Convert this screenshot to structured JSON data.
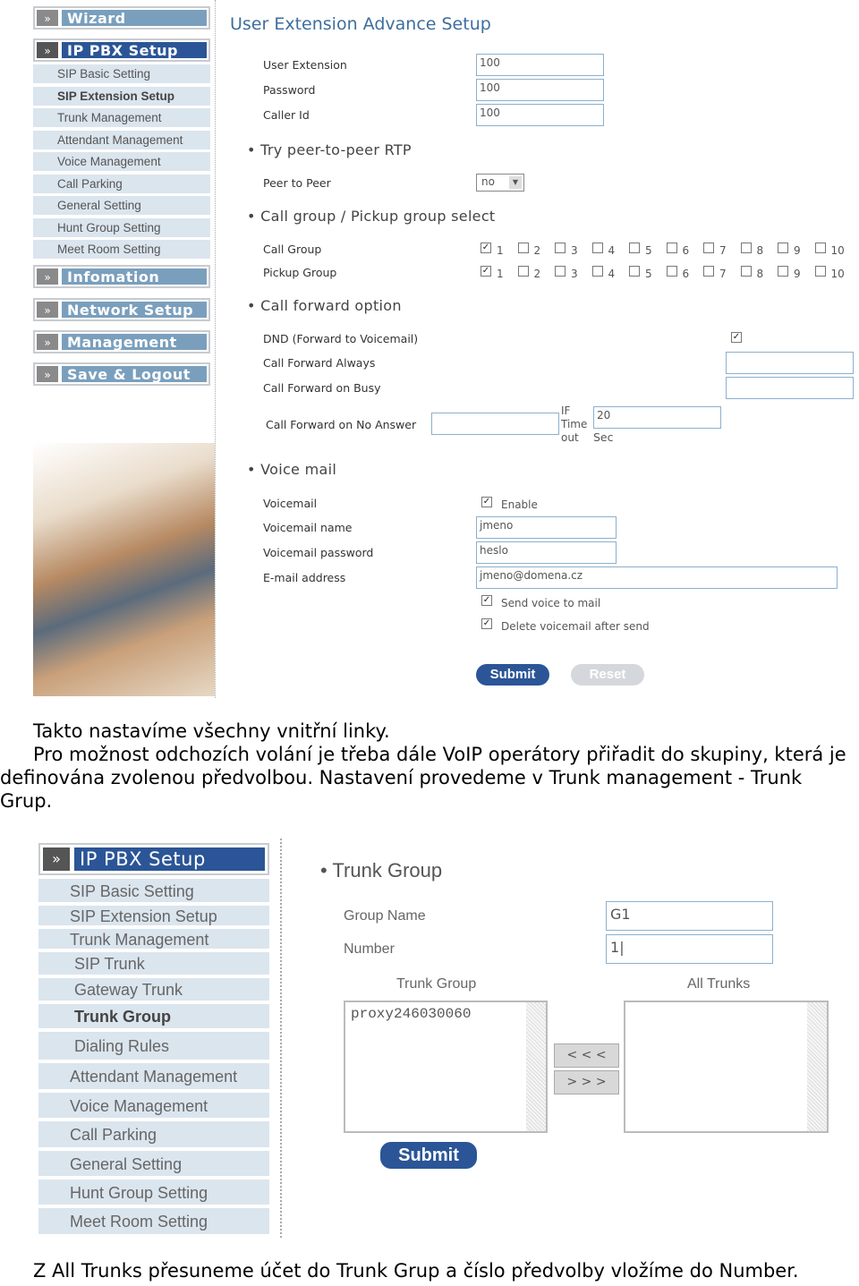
{
  "sidebar1": {
    "wizard": "Wizard",
    "ippbx": "IP PBX Setup",
    "items": [
      "SIP Basic Setting",
      "SIP Extension Setup",
      "Trunk Management",
      "Attendant Management",
      "Voice Management",
      "Call Parking",
      "General Setting",
      "Hunt Group Setting",
      "Meet Room Setting"
    ],
    "info": "Infomation",
    "network": "Network Setup",
    "management": "Management",
    "save": "Save & Logout",
    "arrow": "»"
  },
  "form": {
    "title": "User Extension Advance Setup",
    "user_extension_label": "User Extension",
    "user_extension": "100",
    "password_label": "Password",
    "password": "100",
    "caller_id_label": "Caller Id",
    "caller_id": "100",
    "sec_rtp": "Try peer-to-peer RTP",
    "peer_label": "Peer to Peer",
    "peer_value": "no",
    "sec_group": "Call group / Pickup group select",
    "call_group_label": "Call Group",
    "pickup_group_label": "Pickup Group",
    "group_numbers": [
      "1",
      "2",
      "3",
      "4",
      "5",
      "6",
      "7",
      "8",
      "9",
      "10"
    ],
    "call_group_checked": [
      true,
      false,
      false,
      false,
      false,
      false,
      false,
      false,
      false,
      false
    ],
    "pickup_group_checked": [
      true,
      false,
      false,
      false,
      false,
      false,
      false,
      false,
      false,
      false
    ],
    "sec_forward": "Call forward option",
    "dnd_label": "DND (Forward to Voicemail)",
    "dnd_checked": true,
    "cf_always_label": "Call Forward Always",
    "cf_busy_label": "Call Forward on Busy",
    "cf_noanswer_label": "Call Forward on No Answer",
    "if_timeout_label": "IF Time out",
    "timeout": "20",
    "sec_label": "Sec",
    "sec_voicemail": "Voice mail",
    "voicemail_label": "Voicemail",
    "enable_label": "Enable",
    "enable_checked": true,
    "vm_name_label": "Voicemail name",
    "vm_name": "jmeno",
    "vm_password_label": "Voicemail password",
    "vm_password": "heslo",
    "email_label": "E-mail address",
    "email": "jmeno@domena.cz",
    "send_voice_label": "Send voice to mail",
    "send_voice_checked": true,
    "delete_label": "Delete voicemail after send",
    "delete_checked": true,
    "submit": "Submit",
    "reset": "Reset"
  },
  "text": {
    "p1": "Takto nastavíme všechny vnitřní linky.",
    "p2a": "Pro možnost odchozích volání je třeba dále VoIP operátory přiřadit do skupiny, která je",
    "p2b": "definována zvolenou předvolbou.  Nastavení provedeme v Trunk management  - Trunk",
    "p2c": "Grup.",
    "p3": "Z All Trunks přesuneme účet do Trunk Grup a číslo předvolby vložíme do Number."
  },
  "sidebar2": {
    "ippbx": "IP PBX Setup",
    "arrow": "»",
    "items": [
      "SIP Basic Setting",
      "SIP Extension Setup",
      "Trunk Management",
      "SIP Trunk",
      "Gateway Trunk",
      "Trunk Group",
      "Dialing Rules",
      "Attendant Management",
      "Voice Management",
      "Call Parking",
      "General Setting",
      "Hunt Group Setting",
      "Meet Room Setting"
    ]
  },
  "trunk": {
    "title": "Trunk Group",
    "group_name_label": "Group Name",
    "group_name": "G1",
    "number_label": "Number",
    "number": "1",
    "trunk_group_label": "Trunk Group",
    "all_trunks_label": "All Trunks",
    "trunk_group_items": [
      "proxy246030060"
    ],
    "move_left": "< < <",
    "move_right": "> > >",
    "submit": "Submit"
  }
}
